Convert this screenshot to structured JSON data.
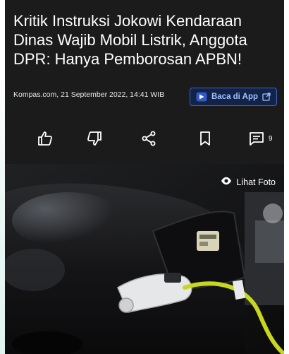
{
  "article": {
    "title": "Kritik Instruksi Jokowi Kendaraan Dinas Wajib Mobil Listrik, Anggota DPR: Hanya Pemborosan APBN!",
    "source_date": "Kompas.com, 21 September 2022, 14:41 WIB"
  },
  "app_button": {
    "label": "Baca di App",
    "icon": "play-badge-icon",
    "ext_icon": "external-link-icon"
  },
  "actions": {
    "items": [
      {
        "name": "like",
        "icon": "thumbs-up-icon"
      },
      {
        "name": "dislike",
        "icon": "thumbs-down-icon"
      },
      {
        "name": "share",
        "icon": "share-icon"
      },
      {
        "name": "bookmark",
        "icon": "bookmark-icon"
      },
      {
        "name": "comment",
        "icon": "comment-icon"
      }
    ],
    "comment_count": "9"
  },
  "photo": {
    "view_label": "Lihat Foto",
    "view_icon": "eye-icon",
    "cable_color": "#c7d61f",
    "car_color": "#1a1a1c"
  }
}
